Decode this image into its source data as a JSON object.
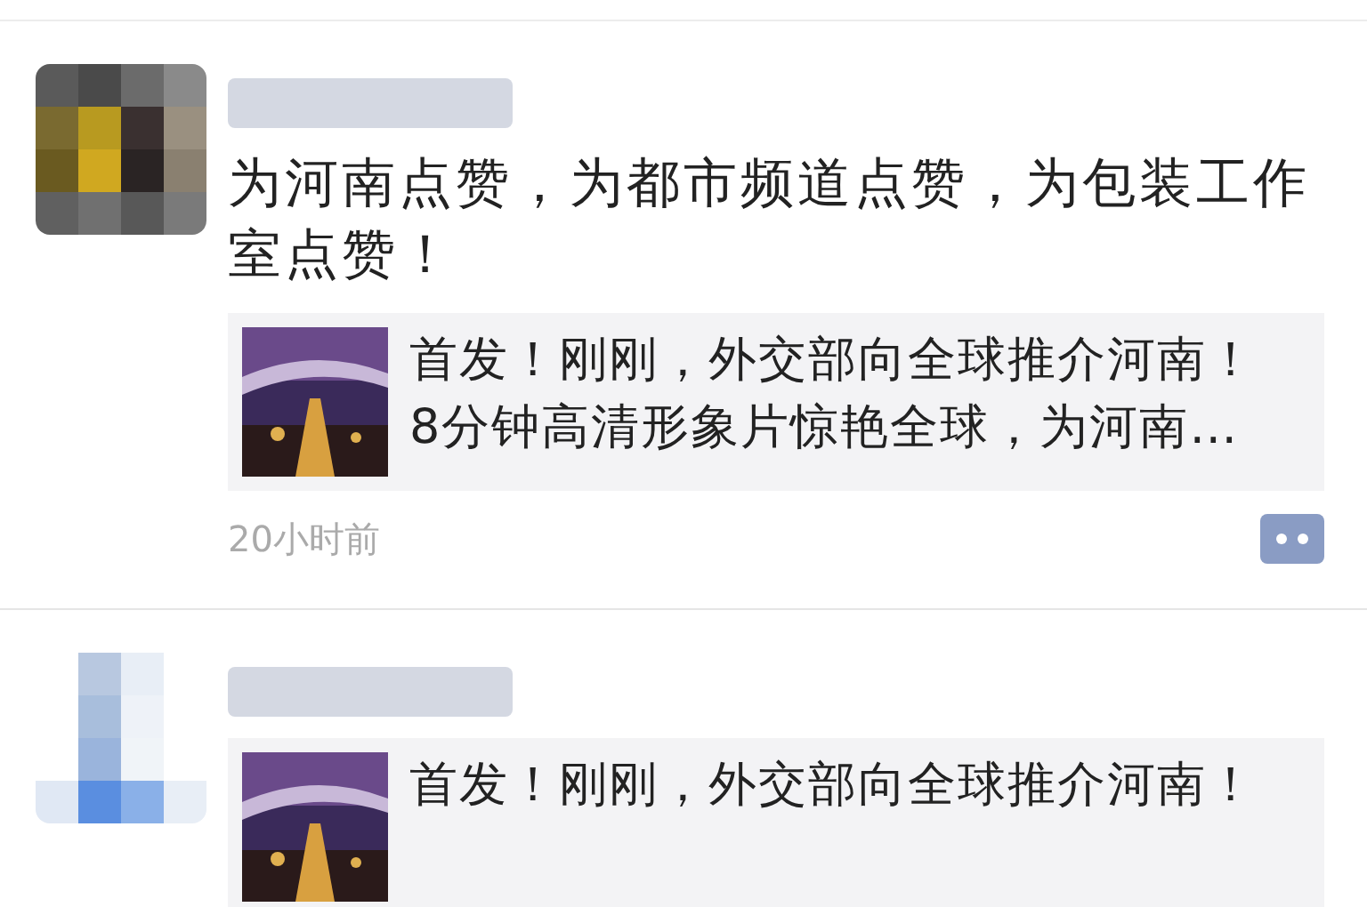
{
  "posts": [
    {
      "avatar": {
        "kind": "mosaic"
      },
      "text": "为河南点赞，为都市频道点赞，为包装工作室点赞！",
      "link": {
        "title_lines": [
          "首发！刚刚，外交部向全球推介河南！",
          "8分钟高清形象片惊艳全球，为河南…"
        ]
      },
      "time": "20小时前"
    },
    {
      "avatar": {
        "kind": "light"
      },
      "link": {
        "title_lines": [
          "首发！刚刚，外交部向全球推介河南！"
        ]
      }
    }
  ]
}
